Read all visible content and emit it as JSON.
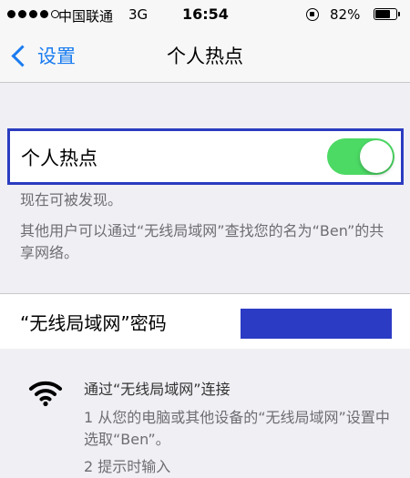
{
  "status_bar": {
    "carrier": "中国联通",
    "network": "3G",
    "time": "16:54",
    "battery": "82%",
    "battery_level": 0.82,
    "signal_bars_filled": 4,
    "signal_bars_total": 5
  },
  "nav": {
    "back_label": "设置",
    "title": "个人热点"
  },
  "hotspot": {
    "label": "个人热点",
    "enabled": true,
    "toggle_color": "#4cd964"
  },
  "notes": {
    "discoverable": "现在可被发现。",
    "info": "其他用户可以通过“无线局域网”查找您的名为“Ben”的共享网络。"
  },
  "password": {
    "label": "“无线局域网”密码",
    "redact_color": "#2c3bc4"
  },
  "instructions": {
    "title": "通过“无线局域网”连接",
    "step1": "1 从您的电脑或其他设备的“无线局域网”设置中选取“Ben”。",
    "step2": "2 提示时输入"
  },
  "colors": {
    "accent": "#1a7cf0",
    "highlight_border": "#2b3cc0",
    "background": "#efeff4"
  }
}
